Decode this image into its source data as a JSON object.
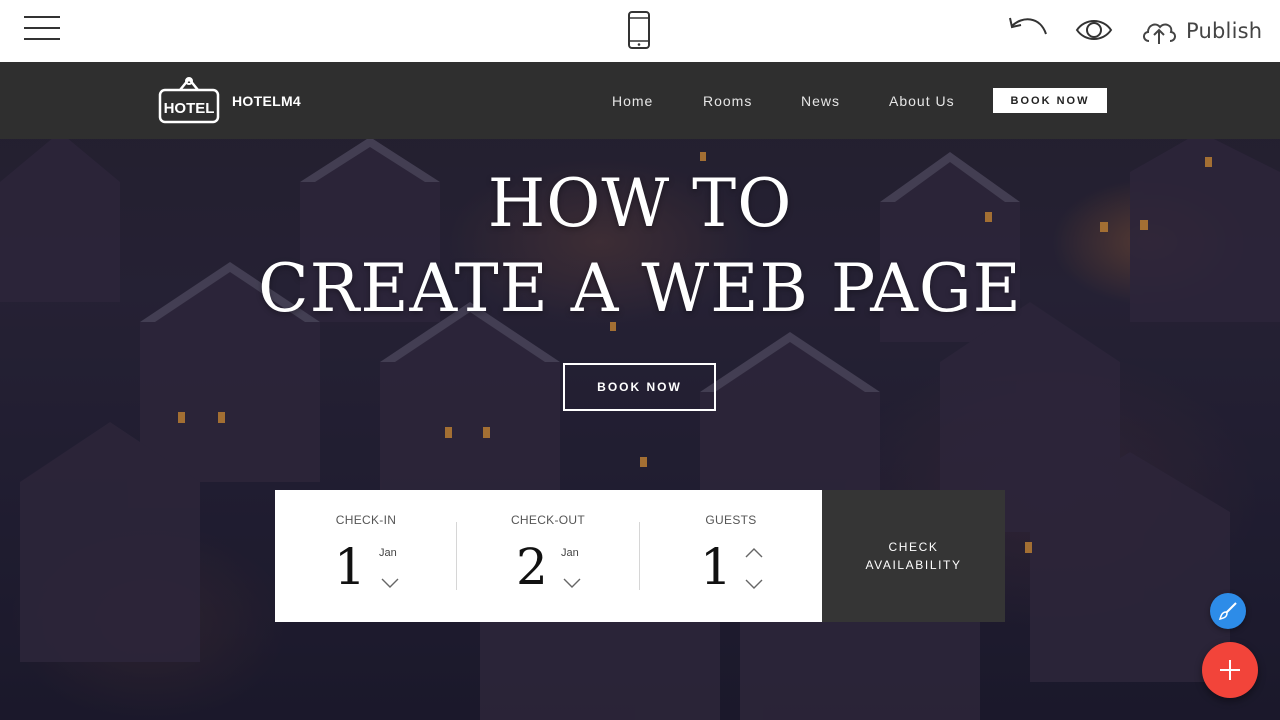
{
  "editor": {
    "publish_label": "Publish",
    "icons": [
      "hamburger-menu-icon",
      "mobile-preview-icon",
      "undo-icon",
      "preview-eye-icon",
      "cloud-upload-icon"
    ]
  },
  "site": {
    "logo_text": "HOTEL",
    "brand": "HOTELM4",
    "nav": [
      {
        "label": "Home"
      },
      {
        "label": "Rooms"
      },
      {
        "label": "News"
      },
      {
        "label": "About Us"
      }
    ],
    "nav_button": "BOOK NOW"
  },
  "hero": {
    "title_line1": "HOW TO",
    "title_line2": "CREATE A WEB PAGE",
    "button": "BOOK NOW"
  },
  "booking": {
    "checkin": {
      "label": "CHECK-IN",
      "day": "1",
      "month": "Jan"
    },
    "checkout": {
      "label": "CHECK-OUT",
      "day": "2",
      "month": "Jan"
    },
    "guests": {
      "label": "GUESTS",
      "count": "1"
    },
    "check_button_line1": "CHECK",
    "check_button_line2": "AVAILABILITY"
  },
  "colors": {
    "nav_bg": "#2f2f2f",
    "check_btn_bg": "#353535",
    "fab_brush": "#2d8ce8",
    "fab_add": "#f2443a"
  }
}
